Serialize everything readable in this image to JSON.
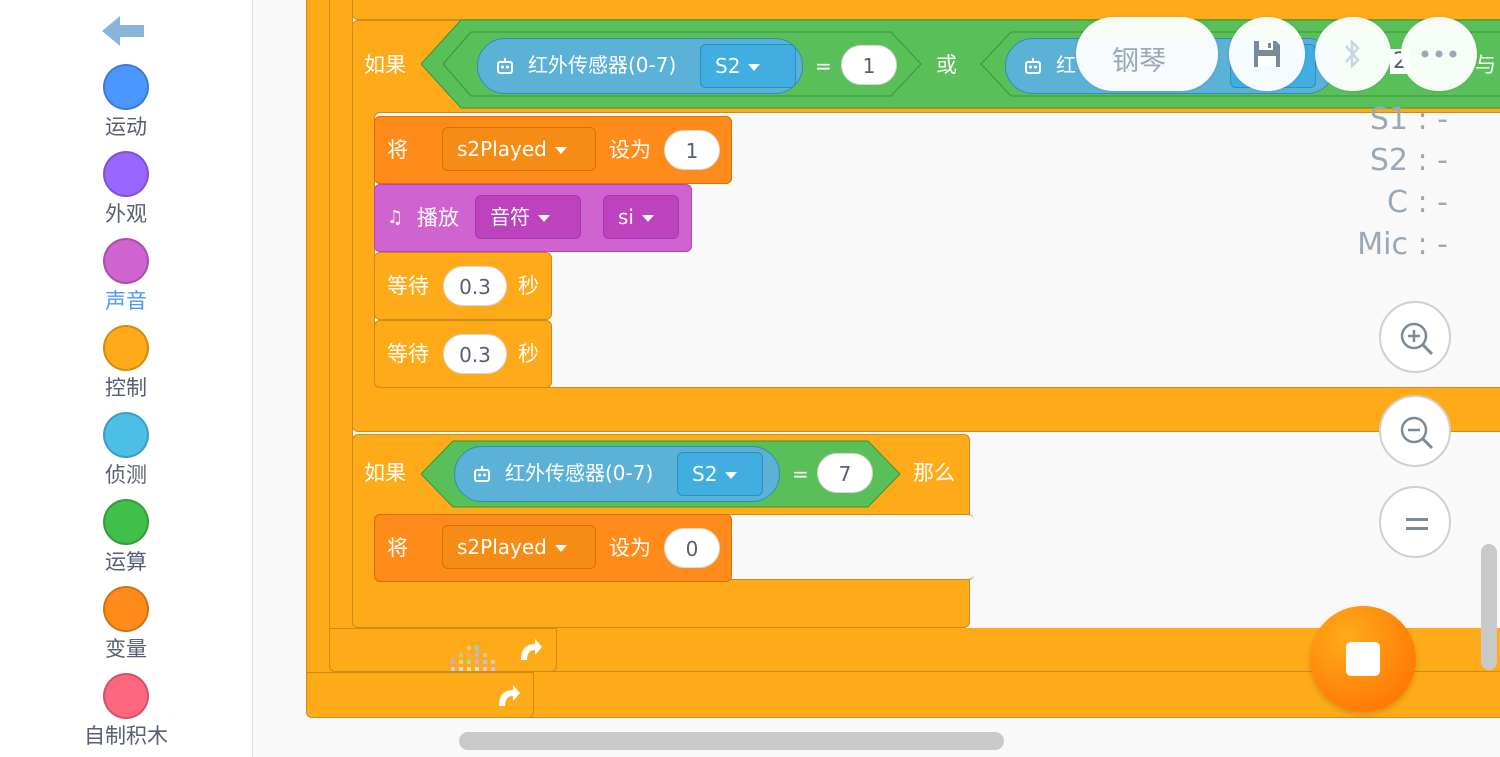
{
  "sidebar": {
    "categories": [
      {
        "label": "运动",
        "color": "#4c97ff"
      },
      {
        "label": "外观",
        "color": "#9966ff"
      },
      {
        "label": "声音",
        "color": "#cf63cf"
      },
      {
        "label": "控制",
        "color": "#ffab19"
      },
      {
        "label": "侦测",
        "color": "#4cbfe6"
      },
      {
        "label": "运算",
        "color": "#40bf4a"
      },
      {
        "label": "变量",
        "color": "#ff8c1a"
      },
      {
        "label": "自制积木",
        "color": "#ff6680"
      }
    ],
    "active": "声音"
  },
  "toolbar": {
    "piano_label": "钢琴",
    "save_icon": "floppy-disk-icon",
    "bluetooth_icon": "bluetooth-icon",
    "more_icon": "ellipsis-icon"
  },
  "readouts": {
    "s1": "S1 : -",
    "s2": "S2 : -",
    "c": "C  : -",
    "mic": "Mic : -",
    "cut_value": "2"
  },
  "blocks": {
    "if1": {
      "label": "如果",
      "sensor1": "红外传感器(0-7)",
      "port1": "S2",
      "eq": "=",
      "value1": "1",
      "or": "或",
      "sensor2_partial": "红",
      "and": "与"
    },
    "set1": {
      "label": "将",
      "var": "s2Played",
      "set_to": "设为",
      "value": "1"
    },
    "play": {
      "label": "播放",
      "type": "音符",
      "note": "si"
    },
    "wait1": {
      "label": "等待",
      "value": "0.3",
      "unit": "秒"
    },
    "wait2": {
      "label": "等待",
      "value": "0.3",
      "unit": "秒"
    },
    "if2": {
      "label": "如果",
      "sensor": "红外传感器(0-7)",
      "port": "S2",
      "eq": "=",
      "value": "7",
      "then": "那么"
    },
    "set2": {
      "label": "将",
      "var": "s2Played",
      "set_to": "设为",
      "value": "0"
    }
  }
}
